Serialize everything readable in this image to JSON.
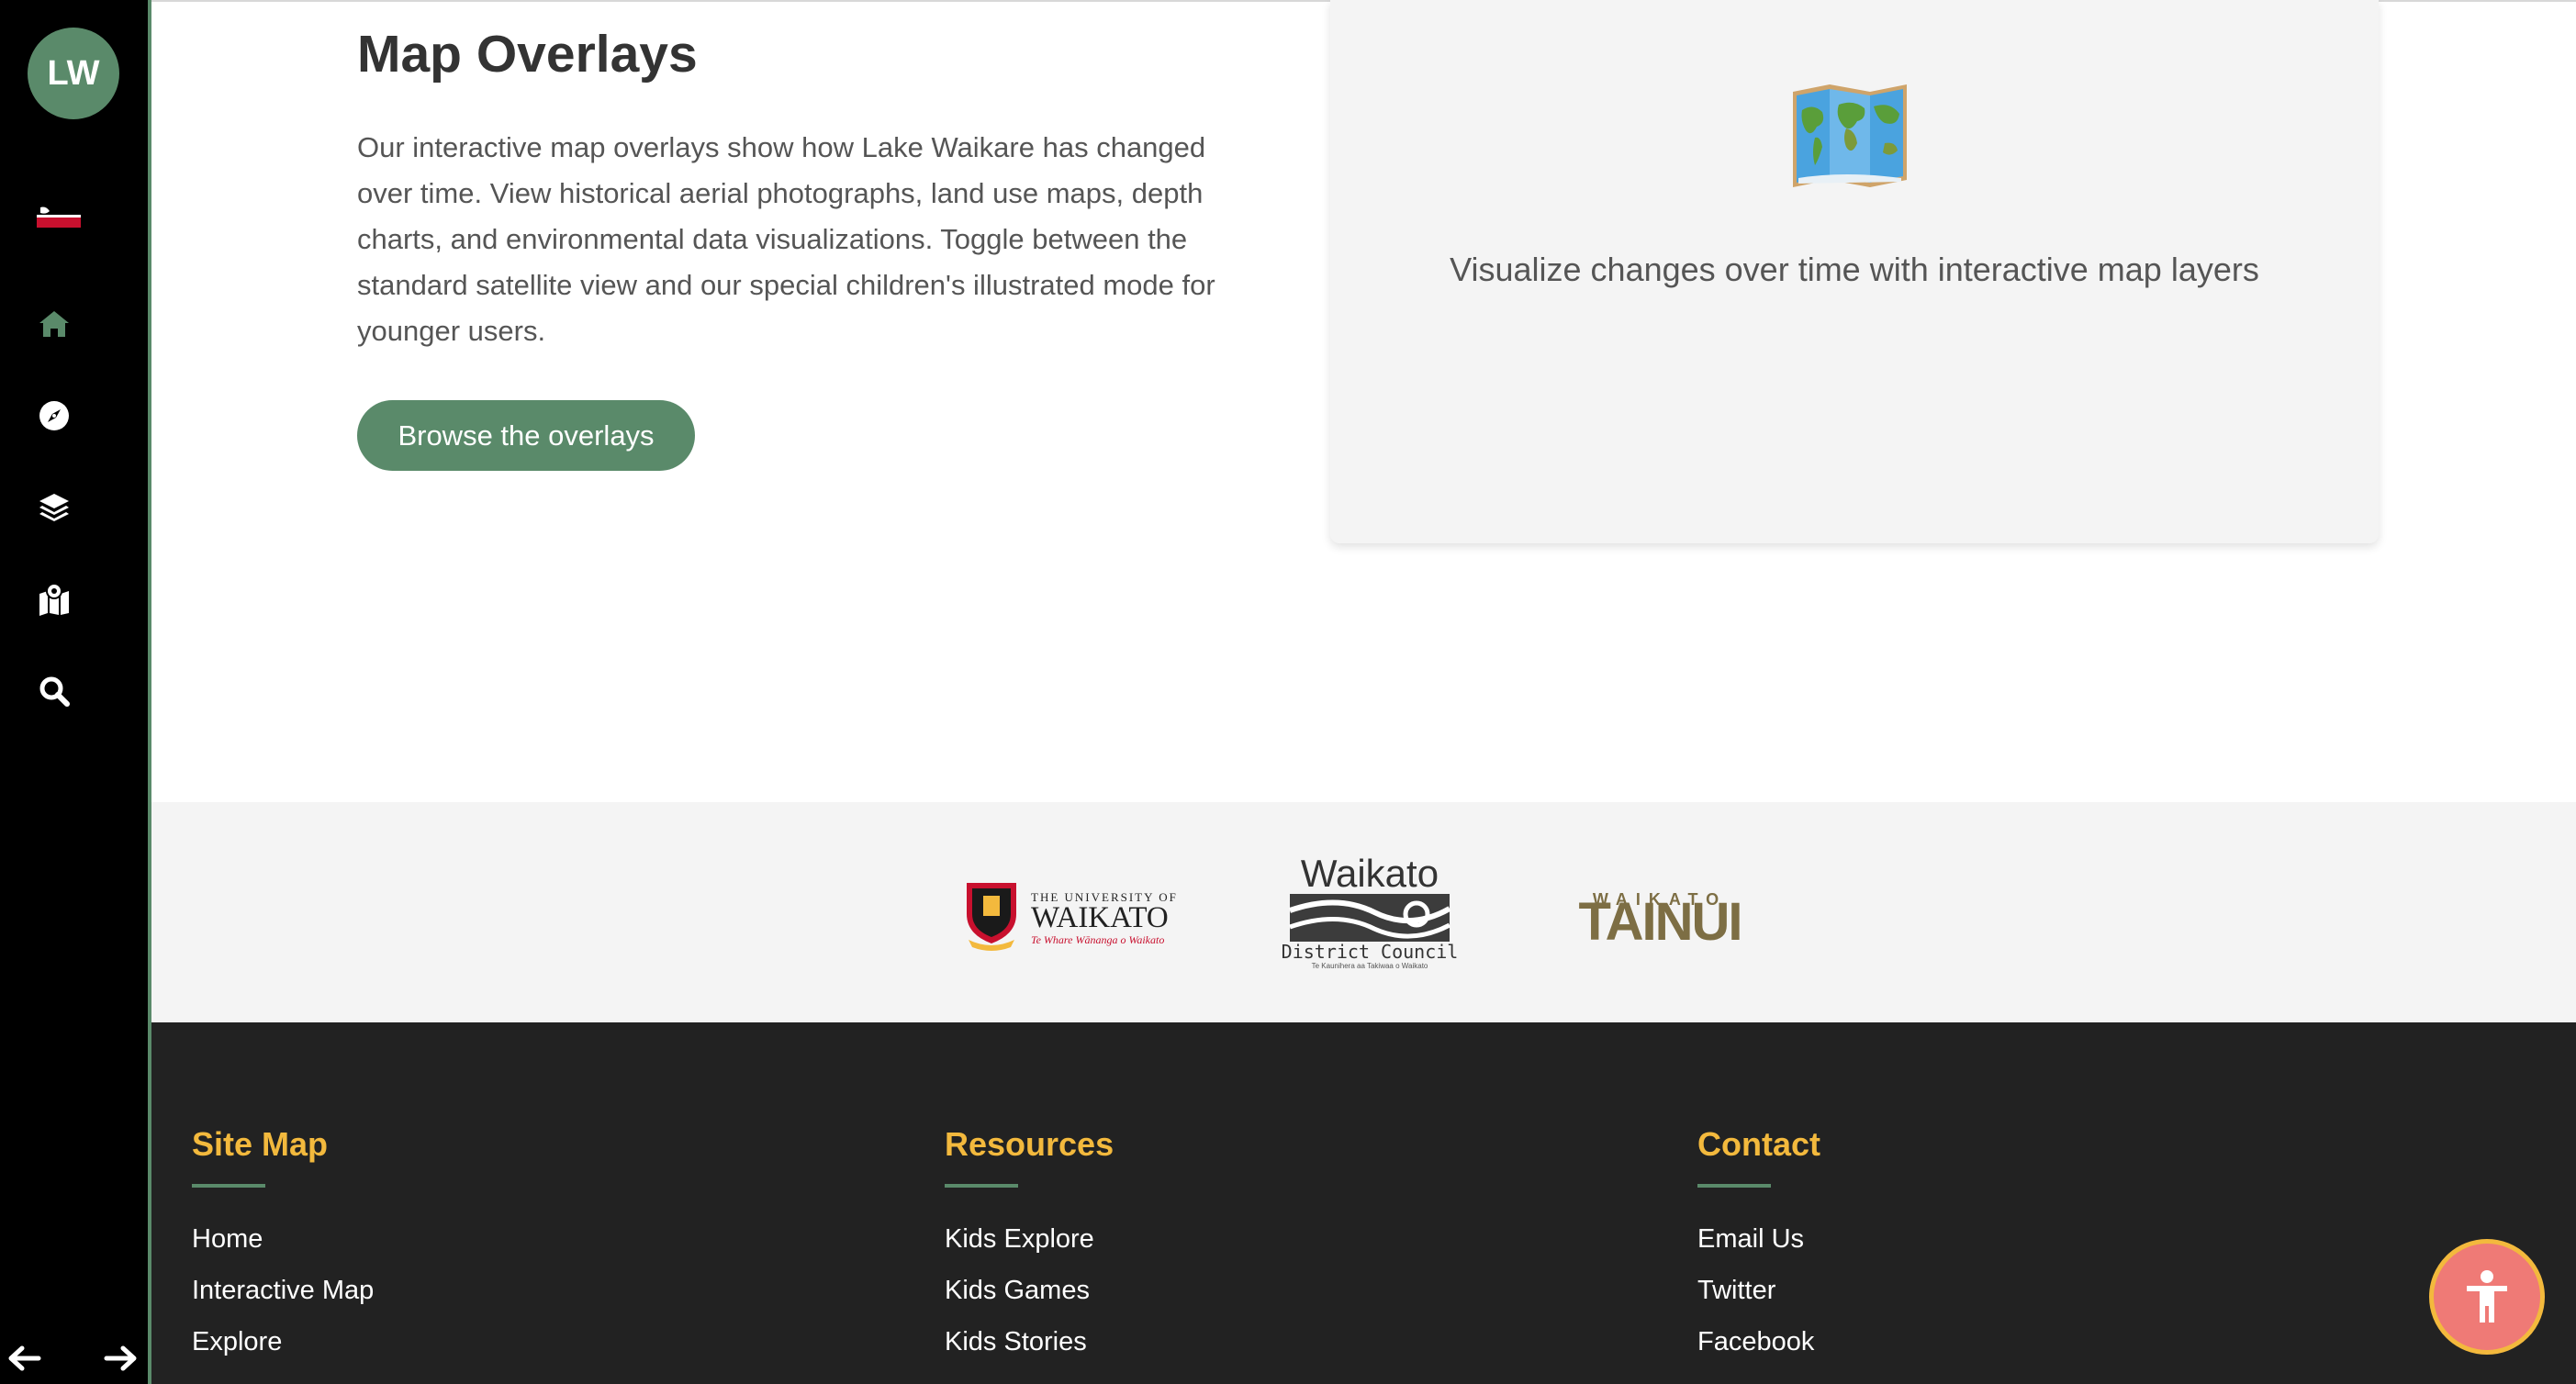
{
  "sidebar": {
    "avatar_initials": "LW",
    "icons": [
      "new-zealand-maori-flag-icon",
      "home-icon",
      "compass-icon",
      "layers-icon",
      "map-marker-icon",
      "search-icon"
    ],
    "back_icon": "arrow-left-icon",
    "forward_icon": "arrow-right-icon",
    "accent_color": "#5a8a6a"
  },
  "overlays": {
    "title": "Map Overlays",
    "description": "Our interactive map overlays show how Lake Waikare has changed over time. View historical aerial photographs, land use maps, depth charts, and environmental data visualizations. Toggle between the standard satellite view and our special children's illustrated mode for younger users.",
    "button_label": "Browse the overlays",
    "card_icon": "world-map-icon",
    "card_caption": "Visualize changes over time with interactive map layers"
  },
  "partners": {
    "uow": {
      "line1": "THE UNIVERSITY OF",
      "line2": "WAIKATO",
      "line3": "Te Whare Wānanga o Waikato"
    },
    "wdc": {
      "line1": "Waikato",
      "line2": "District Council",
      "line3": "Te Kaunihera aa Takiwaa o Waikato"
    },
    "tainui": {
      "line1": "WAIKATO",
      "line2": "TAINUI"
    }
  },
  "footer": {
    "sitemap": {
      "heading": "Site Map",
      "items": [
        "Home",
        "Interactive Map",
        "Explore"
      ]
    },
    "resources": {
      "heading": "Resources",
      "items": [
        "Kids Explore",
        "Kids Games",
        "Kids Stories"
      ]
    },
    "contact": {
      "heading": "Contact",
      "items": [
        "Email Us",
        "Twitter",
        "Facebook"
      ]
    },
    "heading_color": "#f3b93d"
  },
  "accessibility_button": {
    "icon": "accessibility-person-icon",
    "color": "#ef7a76"
  }
}
